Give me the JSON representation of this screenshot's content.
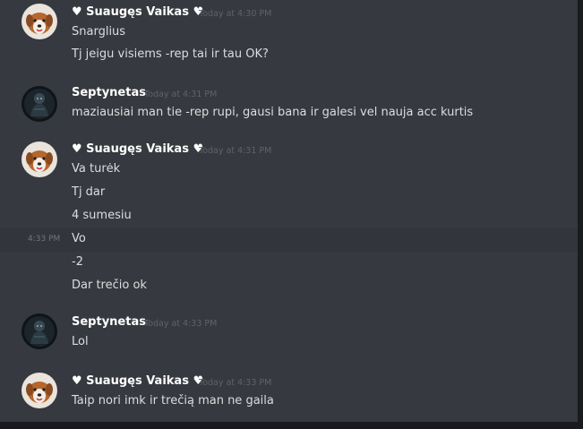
{
  "messages": [
    {
      "author": "♥ Suaugęs Vaikas ♥",
      "timestamp": "Today at 4:30 PM",
      "avatar": "dog-avatar",
      "lines": [
        "Snarglius",
        "Tj jeigu visiems -rep tai ir tau OK?"
      ]
    },
    {
      "author": "Septynetas",
      "timestamp": "Today at 4:31 PM",
      "avatar": "dark-figure-avatar",
      "lines": [
        "maziausiai man tie -rep rupi, gausi bana ir galesi vel nauja acc kurtis"
      ]
    },
    {
      "author": "♥ Suaugęs Vaikas ♥",
      "timestamp": "Today at 4:31 PM",
      "avatar": "dog-avatar",
      "lines": [
        "Va turėk",
        "Tj dar",
        "4 sumesiu"
      ],
      "continuation_time": "4:33 PM",
      "continuation_lines": [
        "Vo",
        "-2",
        "Dar trečio ok"
      ]
    },
    {
      "author": "Septynetas",
      "timestamp": "Today at 4:33 PM",
      "avatar": "dark-figure-avatar",
      "lines": [
        "Lol"
      ]
    },
    {
      "author": "♥ Suaugęs Vaikas ♥",
      "timestamp": "Today at 4:33 PM",
      "avatar": "dog-avatar",
      "lines": [
        "Taip nori imk ir trečią man ne gaila"
      ]
    }
  ],
  "colors": {
    "background": "#36393f",
    "username": "#ffffff",
    "text": "#dcddde",
    "timestamp": "#5f6369"
  }
}
